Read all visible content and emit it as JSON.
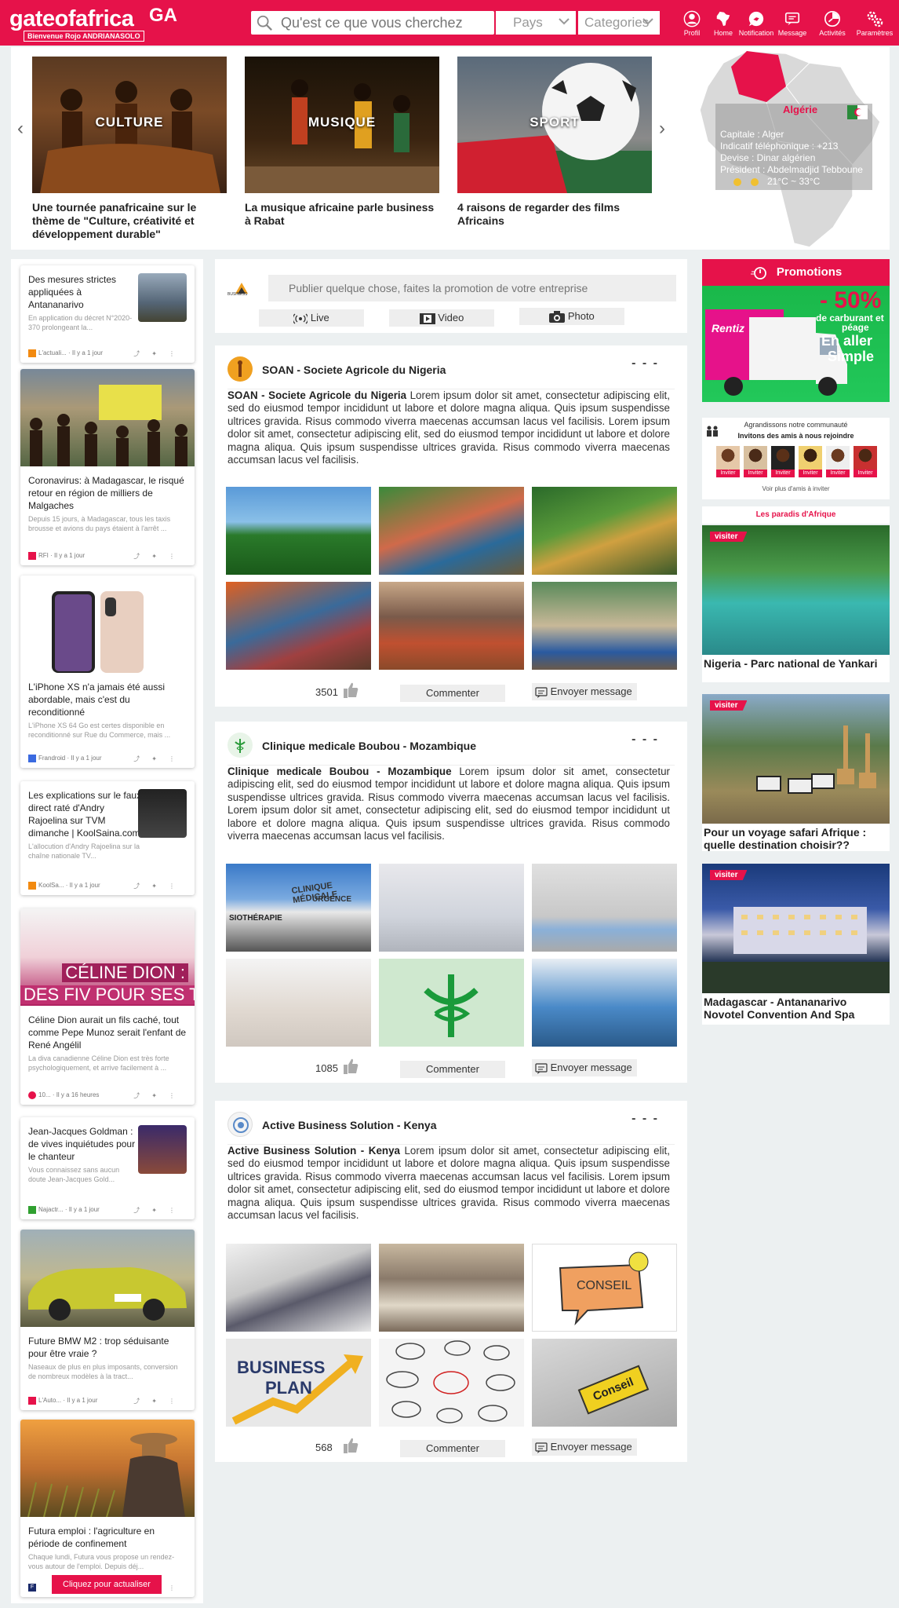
{
  "header": {
    "logo": "gateofafrica",
    "logo_badge": "GA",
    "welcome": "Bienvenue Rojo ANDRIANASOLO",
    "search_placeholder": "Qu'est ce que vous cherchez",
    "country_select": "Pays",
    "category_select": "Categories",
    "nav": [
      "Profil",
      "Home",
      "Notification",
      "Message",
      "Activités",
      "Paramètres"
    ]
  },
  "carousel": [
    {
      "label": "CULTURE",
      "caption": "Une tournée panafricaine sur le thème de \"Culture, créativité et développement durable\""
    },
    {
      "label": "MUSIQUE",
      "caption": "La musique africaine parle business à Rabat"
    },
    {
      "label": "SPORT",
      "caption": "4 raisons de regarder des films Africains"
    }
  ],
  "country_info": {
    "name": "Algérie",
    "lines": [
      "Capitale : Alger",
      "Indicatif téléphonique : +213",
      "Devise : Dinar algérien",
      "Président : Abdelmadjid Tebboune"
    ],
    "weather": "21°C ~ 33°C"
  },
  "news": [
    {
      "title": "Des mesures strictes appliquées à Antananarivo",
      "desc": "En application du décret N°2020-370 prolongeant la...",
      "source": "L'actuali...",
      "time": "· Il y a 1 jour"
    },
    {
      "title": "Coronavirus: à Madagascar, le risqué retour en région de milliers de Malgaches",
      "desc": "Depuis 15 jours, à Madagascar, tous les taxis brousse et avions du pays étaient à l'arrêt ...",
      "source": "RFI",
      "time": "· Il y a 1 jour"
    },
    {
      "title": "L'iPhone XS n'a jamais été aussi abordable, mais c'est du reconditionné",
      "desc": "L'iPhone XS 64 Go est certes disponible en reconditionné sur Rue du Commerce, mais ...",
      "source": "Frandroid",
      "time": "· Il y a 1 jour"
    },
    {
      "title": "Les explications sur le faux direct raté d'Andry Rajoelina sur TVM dimanche | KoolSaina.com",
      "desc": "L'allocution d'Andry Rajoelina sur la chaîne nationale TV...",
      "source": "KoolSa...",
      "time": "· Il y a 1 jour"
    },
    {
      "title": "Céline Dion aurait un fils caché, tout comme Pepe Munoz serait l'enfant de René Angélil",
      "desc": "La diva canadienne Céline Dion est très forte psychologiquement, et arrive facilement à ...",
      "source": "10...",
      "time": "· Il y a 16 heures",
      "banner": "CÉLINE DION :",
      "banner2": "DES FIV POUR SES T"
    },
    {
      "title": "Jean-Jacques Goldman : de vives inquiétudes pour le chanteur",
      "desc": "Vous connaissez sans aucun doute Jean-Jacques Gold...",
      "source": "Najactr...",
      "time": "· Il y a 1 jour"
    },
    {
      "title": "Future BMW M2 : trop séduisante pour être vraie ?",
      "desc": "Naseaux de plus en plus imposants, conversion de nombreux modèles à la tract...",
      "source": "L'Auto...",
      "time": "· Il y a 1 jour"
    },
    {
      "title": "Futura emploi : l'agriculture en période de confinement",
      "desc": "Chaque lundi, Futura vous propose un rendez-vous autour de l'emploi. Depuis déj...",
      "source": "F",
      "time": ""
    }
  ],
  "refresh_label": "Cliquez pour actualiser",
  "composer": {
    "placeholder": "Publier quelque chose, faites la promotion de votre entreprise",
    "logo_text": "BUSINESS",
    "live": "Live",
    "video": "Video",
    "photo": "Photo"
  },
  "posts": [
    {
      "name": "SOAN - Societe Agricole du Nigeria",
      "text": "Lorem ipsum dolor sit amet, consectetur adipiscing elit, sed do eiusmod tempor incididunt ut labore et dolore magna aliqua. Quis ipsum suspendisse ultrices gravida. Risus commodo viverra maecenas accumsan lacus vel facilisis. Lorem ipsum dolor sit amet, consectetur adipiscing elit, sed do eiusmod tempor incididunt ut labore et dolore magna aliqua. Quis ipsum suspendisse ultrices gravida. Risus commodo viverra maecenas accumsan lacus vel facilisis.",
      "likes": "3501",
      "comment": "Commenter",
      "message": "Envoyer message",
      "more": "- - -"
    },
    {
      "name": "Clinique medicale Boubou - Mozambique",
      "text": "Lorem ipsum dolor sit amet, consectetur adipiscing elit, sed do eiusmod tempor incididunt ut labore et dolore magna aliqua. Quis ipsum suspendisse ultrices gravida. Risus commodo viverra maecenas accumsan lacus vel facilisis. Lorem ipsum dolor sit amet, consectetur adipiscing elit, sed do eiusmod tempor incididunt ut labore et dolore magna aliqua. Quis ipsum suspendisse ultrices gravida. Risus commodo viverra maecenas accumsan lacus vel facilisis.",
      "likes": "1085",
      "comment": "Commenter",
      "message": "Envoyer message",
      "more": "- - -",
      "photo_texts": [
        "CLINIQUE MÉDICALE",
        "URGENCE",
        "SIOTHÉRAPIE"
      ]
    },
    {
      "name": "Active Business Solution - Kenya",
      "text": "Lorem ipsum dolor sit amet, consectetur adipiscing elit, sed do eiusmod tempor incididunt ut labore et dolore magna aliqua. Quis ipsum suspendisse ultrices gravida. Risus commodo viverra maecenas accumsan lacus vel facilisis. Lorem ipsum dolor sit amet, consectetur adipiscing elit, sed do eiusmod tempor incididunt ut labore et dolore magna aliqua. Quis ipsum suspendisse ultrices gravida. Risus commodo viverra maecenas accumsan lacus vel facilisis.",
      "likes": "568",
      "comment": "Commenter",
      "message": "Envoyer message",
      "more": "- - -",
      "photo_texts": [
        "CONSEIL",
        "BUSINESS",
        "PLAN",
        "Conseil"
      ]
    }
  ],
  "promotions": {
    "title": "Promotions",
    "ad_big": "- 50%",
    "ad_line1": "de carburant et",
    "ad_line2": "péage",
    "ad_line3": "En aller",
    "ad_line4": "Simple",
    "ad_brand": "Rentiz"
  },
  "invite": {
    "line1": "Agrandissons notre communauté",
    "line2": "Invitons des amis à nous rejoindre",
    "button": "Inviter",
    "more": "Voir plus d'amis à inviter"
  },
  "paradis": {
    "title": "Les paradis d'Afrique",
    "tag": "visiter",
    "items": [
      "Nigeria - Parc national de Yankari",
      "Pour un voyage safari Afrique : quelle destination choisir??",
      "Madagascar - Antananarivo Novotel Convention And Spa"
    ]
  },
  "colors": {
    "brand": "#e6124a",
    "background": "#ecf0f1"
  }
}
